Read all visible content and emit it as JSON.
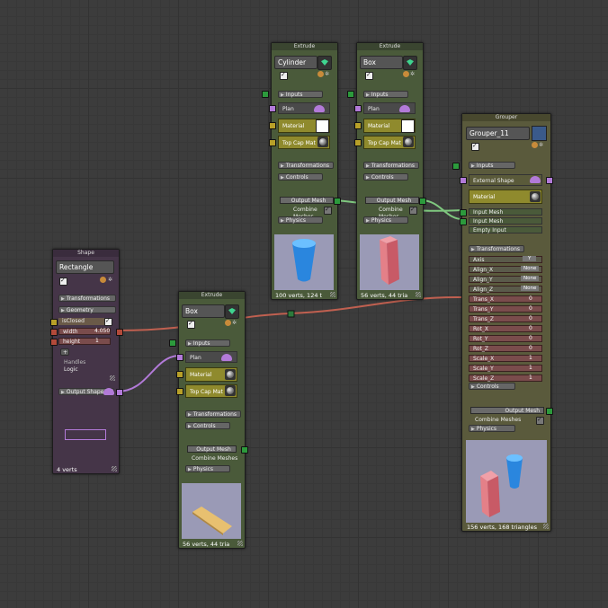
{
  "colors": {
    "canvas": "#3c3c3c",
    "node_green": "#4a5a3a",
    "node_purple": "#453548",
    "node_olive": "#5a5a3c",
    "material_yellow": "#8f8a2d",
    "wire_red": "#c06050",
    "wire_purple": "#b27ad8",
    "wire_green": "#7fc87f",
    "preview_bg": "#9a9ab6"
  },
  "shape_node": {
    "title": "Shape",
    "name": "Rectangle",
    "transformations_label": "Transformations",
    "geometry_label": "Geometry",
    "isclosed_label": "isClosed",
    "width_label": "width",
    "width_value": "4.050",
    "height_label": "height",
    "height_value": "1",
    "add_label": "+",
    "handles_label": "Handles",
    "logic_label": "Logic",
    "output_label": "Output Shape",
    "footer": "4 verts"
  },
  "extrude_cylinder": {
    "title": "Extrude",
    "name": "Cylinder",
    "inputs_label": "Inputs",
    "plan_label": "Plan",
    "material_label": "Material",
    "topcap_label": "Top Cap Mat",
    "transformations_label": "Transformations",
    "controls_label": "Controls",
    "output_label": "Output Mesh",
    "combine_label": "Combine Meshes",
    "physics_label": "Physics",
    "footer": "100 verts, 124 t"
  },
  "extrude_box_top": {
    "title": "Extrude",
    "name": "Box",
    "inputs_label": "Inputs",
    "plan_label": "Plan",
    "material_label": "Material",
    "topcap_label": "Top Cap Mat",
    "transformations_label": "Transformations",
    "controls_label": "Controls",
    "output_label": "Output Mesh",
    "combine_label": "Combine Meshes",
    "physics_label": "Physics",
    "footer": "56 verts, 44 tria"
  },
  "extrude_box_bottom": {
    "title": "Extrude",
    "name": "Box",
    "inputs_label": "Inputs",
    "plan_label": "Plan",
    "material_label": "Material",
    "topcap_label": "Top Cap Mat",
    "transformations_label": "Transformations",
    "controls_label": "Controls",
    "output_label": "Output Mesh",
    "combine_label": "Combine Meshes",
    "physics_label": "Physics",
    "footer": "56 verts, 44 tria"
  },
  "grouper": {
    "title": "Grouper",
    "name": "Grouper_11",
    "inputs_label": "Inputs",
    "external_shape_label": "External Shape",
    "material_label": "Material",
    "input_mesh_1": "Input Mesh",
    "input_mesh_2": "Input Mesh",
    "empty_input": "Empty Input",
    "transformations_label": "Transformations",
    "axis_label": "Axis",
    "axis_value": "Y",
    "align_x_label": "Align_X",
    "align_x_value": "None",
    "align_y_label": "Align_Y",
    "align_y_value": "None",
    "align_z_label": "Align_Z",
    "align_z_value": "None",
    "trans_x_label": "Trans_X",
    "trans_x_value": "0",
    "trans_y_label": "Trans_Y",
    "trans_y_value": "0",
    "trans_z_label": "Trans_Z",
    "trans_z_value": "0",
    "rot_x_label": "Rot_X",
    "rot_x_value": "0",
    "rot_y_label": "Rot_Y",
    "rot_y_value": "0",
    "rot_z_label": "Rot_Z",
    "rot_z_value": "0",
    "scale_x_label": "Scale_X",
    "scale_x_value": "1",
    "scale_y_label": "Scale_Y",
    "scale_y_value": "1",
    "scale_z_label": "Scale_Z",
    "scale_z_value": "1",
    "controls_label": "Controls",
    "output_label": "Output Mesh",
    "combine_label": "Combine Meshes",
    "physics_label": "Physics",
    "footer": "156 verts, 168 triangles"
  },
  "icons": [
    "gem-icon",
    "info-icon",
    "gear-icon",
    "shape-icon",
    "material-ball-icon",
    "resize-grip-icon",
    "checkbox-icon"
  ]
}
